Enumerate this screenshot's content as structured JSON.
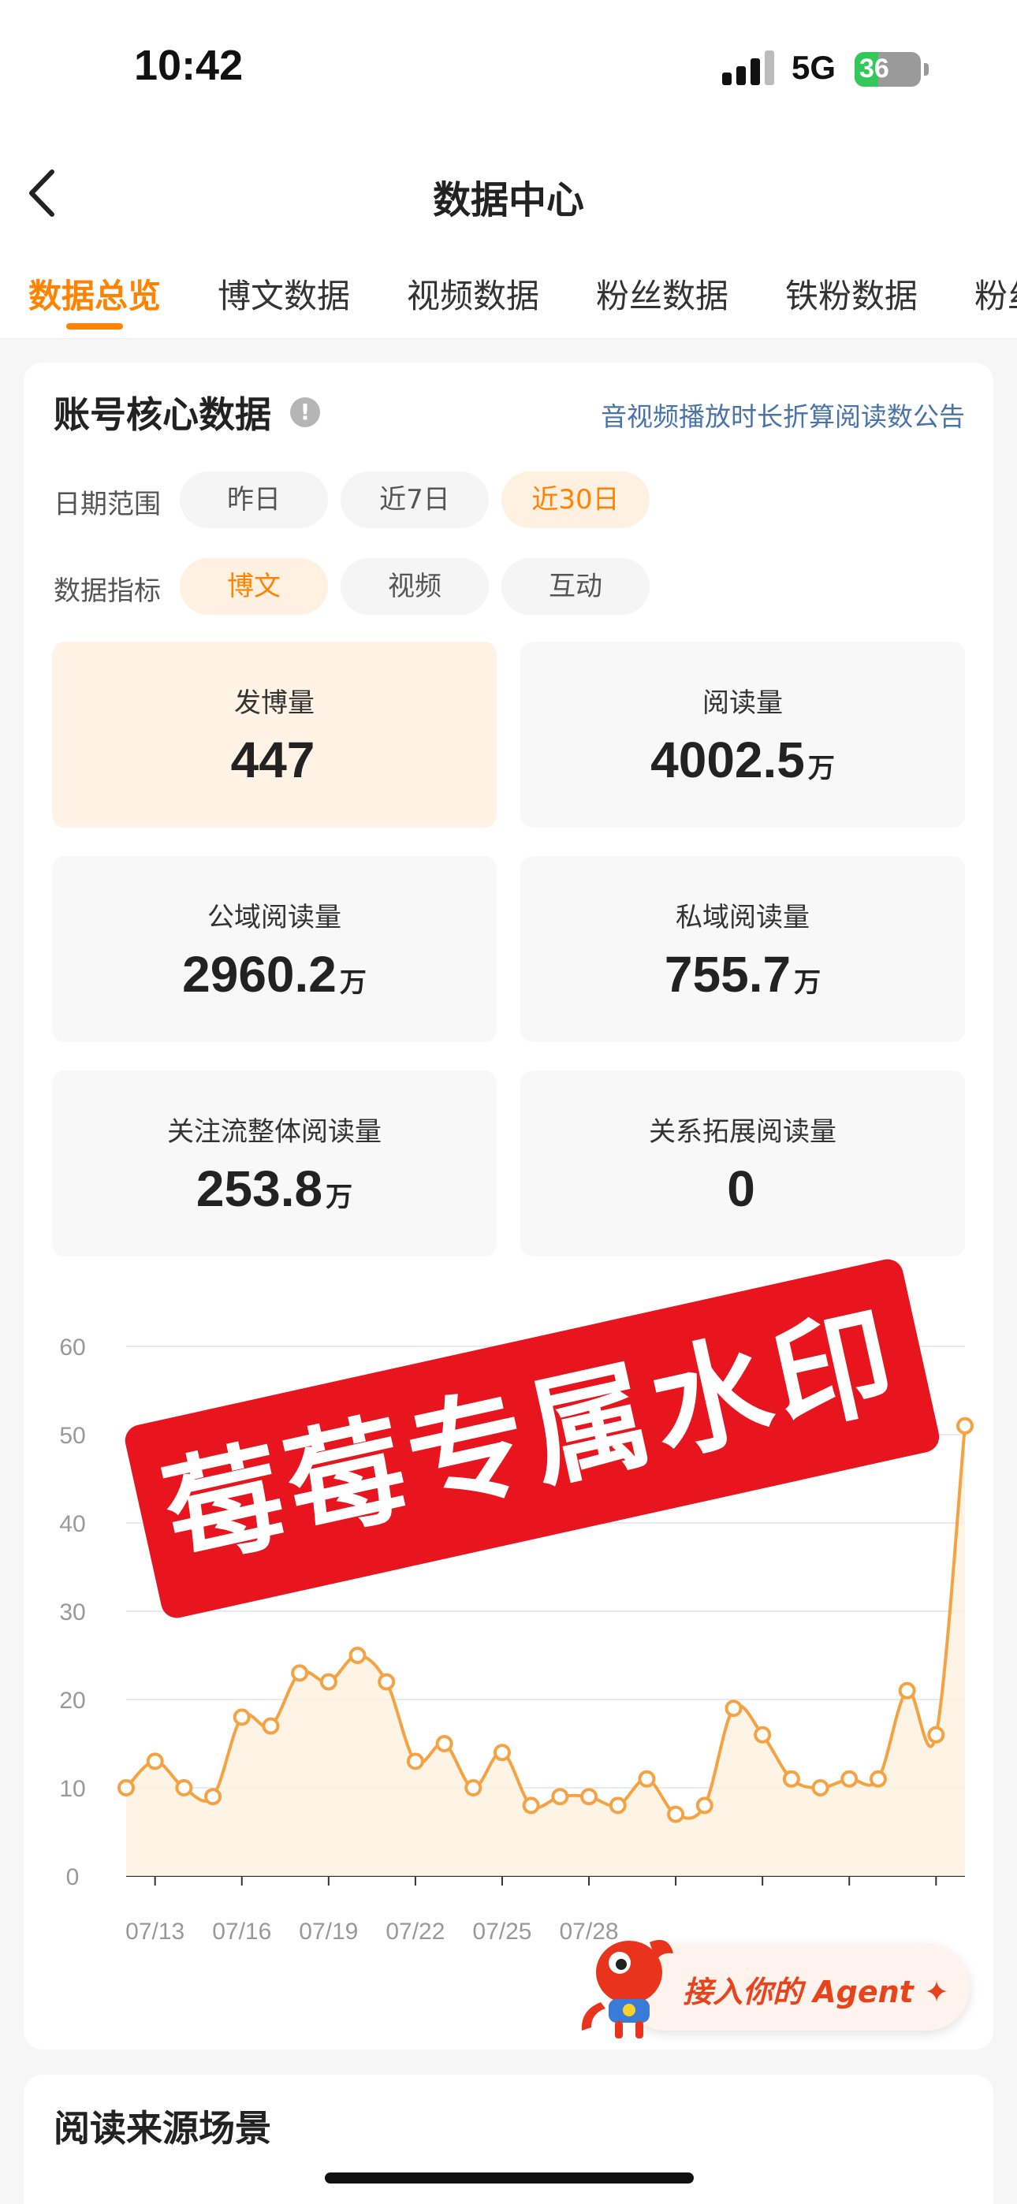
{
  "status_bar": {
    "time": "10:42",
    "network": "5G",
    "battery": "36",
    "battery_level": 0.36
  },
  "nav": {
    "title": "数据中心"
  },
  "tabs": [
    {
      "label": "数据总览",
      "active": true
    },
    {
      "label": "博文数据"
    },
    {
      "label": "视频数据"
    },
    {
      "label": "粉丝数据"
    },
    {
      "label": "铁粉数据"
    },
    {
      "label": "粉丝"
    }
  ],
  "core": {
    "title": "账号核心数据",
    "info_glyph": "!",
    "notice_link": "音视频播放时长折算阅读数公告",
    "date_range_label": "日期范围",
    "date_options": [
      "昨日",
      "近7日",
      "近30日"
    ],
    "date_selected": "近30日",
    "metric_label": "数据指标",
    "metric_options": [
      "博文",
      "视频",
      "互动"
    ],
    "metric_selected": "博文",
    "metrics": [
      {
        "label": "发博量",
        "value": "447",
        "unit": ""
      },
      {
        "label": "阅读量",
        "value": "4002.5",
        "unit": "万"
      },
      {
        "label": "公域阅读量",
        "value": "2960.2",
        "unit": "万"
      },
      {
        "label": "私域阅读量",
        "value": "755.7",
        "unit": "万"
      },
      {
        "label": "关注流整体阅读量",
        "value": "253.8",
        "unit": "万"
      },
      {
        "label": "关系拓展阅读量",
        "value": "0",
        "unit": ""
      }
    ]
  },
  "chart_data": {
    "type": "line",
    "x": [
      "07/12",
      "07/13",
      "07/14",
      "07/15",
      "07/16",
      "07/17",
      "07/18",
      "07/19",
      "07/20",
      "07/21",
      "07/22",
      "07/23",
      "07/24",
      "07/25",
      "07/26",
      "07/27",
      "07/28",
      "07/29",
      "07/30",
      "07/31",
      "08/01",
      "08/02",
      "08/03",
      "08/04",
      "08/05",
      "08/06",
      "08/07",
      "08/08",
      "08/09",
      "08/10"
    ],
    "y": [
      10,
      13,
      10,
      9,
      18,
      17,
      23,
      22,
      25,
      22,
      13,
      15,
      10,
      14,
      8,
      9,
      9,
      8,
      11,
      7,
      8,
      19,
      16,
      11,
      10,
      11,
      11,
      21,
      16,
      51
    ],
    "xtick_labels": [
      "07/13",
      "07/16",
      "07/19",
      "07/22",
      "07/25",
      "07/28"
    ],
    "yticks": [
      "0",
      "10",
      "20",
      "30",
      "40",
      "50",
      "60"
    ],
    "ylim": [
      0,
      60
    ],
    "grid": true,
    "line_color": "#f5a243"
  },
  "watermark": {
    "text": "莓莓专属水印"
  },
  "agent_button": {
    "label": "接入你的 Agent",
    "sparkle": "✦"
  },
  "section2": {
    "title": "阅读来源场景"
  }
}
